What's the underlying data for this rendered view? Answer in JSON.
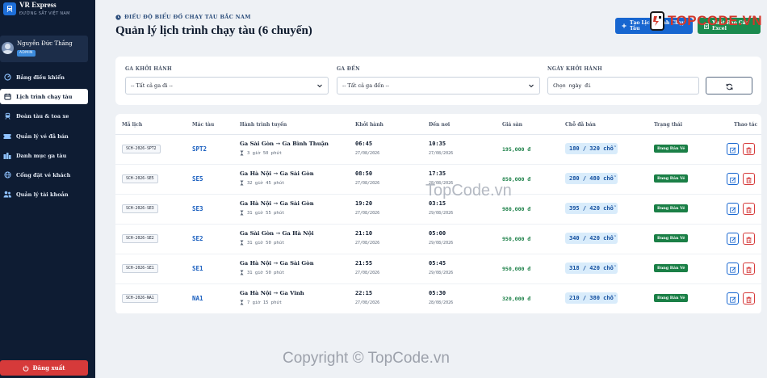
{
  "brand": {
    "title": "VR Express",
    "subtitle": "ĐƯỜNG SẮT VIỆT NAM"
  },
  "user": {
    "name": "Nguyễn Đức Thắng",
    "role": "ADMIN"
  },
  "nav": [
    {
      "label": "Bảng điều khiển",
      "icon": "dashboard-icon",
      "active": false
    },
    {
      "label": "Lịch trình chạy tàu",
      "icon": "calendar-icon",
      "active": true
    },
    {
      "label": "Đoàn tàu & toa xe",
      "icon": "train-icon",
      "active": false
    },
    {
      "label": "Quản lý vé đã bán",
      "icon": "ticket-icon",
      "active": false
    },
    {
      "label": "Danh mục ga tàu",
      "icon": "station-icon",
      "active": false
    },
    {
      "label": "Cổng đặt vé khách",
      "icon": "globe-icon",
      "active": false
    },
    {
      "label": "Quản lý tài khoản",
      "icon": "users-icon",
      "active": false
    }
  ],
  "logout_label": "Đăng xuất",
  "header": {
    "eyebrow": "ĐIỀU ĐỘ BIỂU ĐỒ CHẠY TÀU BẮC NAM",
    "title": "Quản lý lịch trình chạy tàu (6 chuyến)",
    "create_label": "Tạo Lịch Trình Chạy Tàu",
    "excel_label": "Xuất Báo Cáo Excel"
  },
  "watermark": {
    "logo_text": "TOPCODE.VN",
    "mid": "TopCode.vn",
    "bottom": "Copyright © TopCode.vn"
  },
  "filters": {
    "departure_label": "GA KHỞI HÀNH",
    "departure_value": "-- Tất cả ga đi --",
    "arrival_label": "GA ĐẾN",
    "arrival_value": "-- Tất cả ga đến --",
    "date_label": "NGÀY KHỞI HÀNH",
    "date_placeholder": "Chọn ngày đi"
  },
  "table": {
    "columns": [
      "Mã lịch",
      "Mác tàu",
      "Hành trình tuyến",
      "Khởi hành",
      "Đến nơi",
      "Giá sàn",
      "Chỗ đã bán",
      "Trạng thái",
      "Thao tác"
    ],
    "rows": [
      {
        "code": "SCH-2026-SPT2",
        "train": "SPT2",
        "route": "Ga Sài Gòn → Ga Bình Thuận",
        "duration": "3 giờ 50 phút",
        "dep_time": "06:45",
        "dep_date": "27/08/2026",
        "arr_time": "10:35",
        "arr_date": "27/08/2026",
        "price": "195,000 đ",
        "seats": "180 / 320 chỗ",
        "status": "Đang Bán Vé"
      },
      {
        "code": "SCH-2026-SE5",
        "train": "SE5",
        "route": "Ga Hà Nội → Ga Sài Gòn",
        "duration": "32 giờ 45 phút",
        "dep_time": "08:50",
        "dep_date": "27/08/2026",
        "arr_time": "17:35",
        "arr_date": "28/08/2026",
        "price": "850,000 đ",
        "seats": "280 / 480 chỗ",
        "status": "Đang Bán Vé"
      },
      {
        "code": "SCH-2026-SE3",
        "train": "SE3",
        "route": "Ga Hà Nội → Ga Sài Gòn",
        "duration": "31 giờ 55 phút",
        "dep_time": "19:20",
        "dep_date": "27/08/2026",
        "arr_time": "03:15",
        "arr_date": "29/08/2026",
        "price": "980,000 đ",
        "seats": "395 / 420 chỗ",
        "status": "Đang Bán Vé"
      },
      {
        "code": "SCH-2026-SE2",
        "train": "SE2",
        "route": "Ga Sài Gòn → Ga Hà Nội",
        "duration": "31 giờ 50 phút",
        "dep_time": "21:10",
        "dep_date": "27/08/2026",
        "arr_time": "05:00",
        "arr_date": "29/08/2026",
        "price": "950,000 đ",
        "seats": "340 / 420 chỗ",
        "status": "Đang Bán Vé"
      },
      {
        "code": "SCH-2026-SE1",
        "train": "SE1",
        "route": "Ga Hà Nội → Ga Sài Gòn",
        "duration": "31 giờ 50 phút",
        "dep_time": "21:55",
        "dep_date": "27/08/2026",
        "arr_time": "05:45",
        "arr_date": "29/08/2026",
        "price": "950,000 đ",
        "seats": "318 / 420 chỗ",
        "status": "Đang Bán Vé"
      },
      {
        "code": "SCH-2026-NA1",
        "train": "NA1",
        "route": "Ga Hà Nội → Ga Vinh",
        "duration": "7 giờ 15 phút",
        "dep_time": "22:15",
        "dep_date": "27/08/2026",
        "arr_time": "05:30",
        "arr_date": "28/08/2026",
        "price": "320,000 đ",
        "seats": "210 / 380 chỗ",
        "status": "Đang Bán Vé"
      }
    ]
  },
  "colors": {
    "sidebar": "#0e1c33",
    "primary": "#1766d0",
    "success": "#1a7f46",
    "danger": "#d63a3a"
  }
}
